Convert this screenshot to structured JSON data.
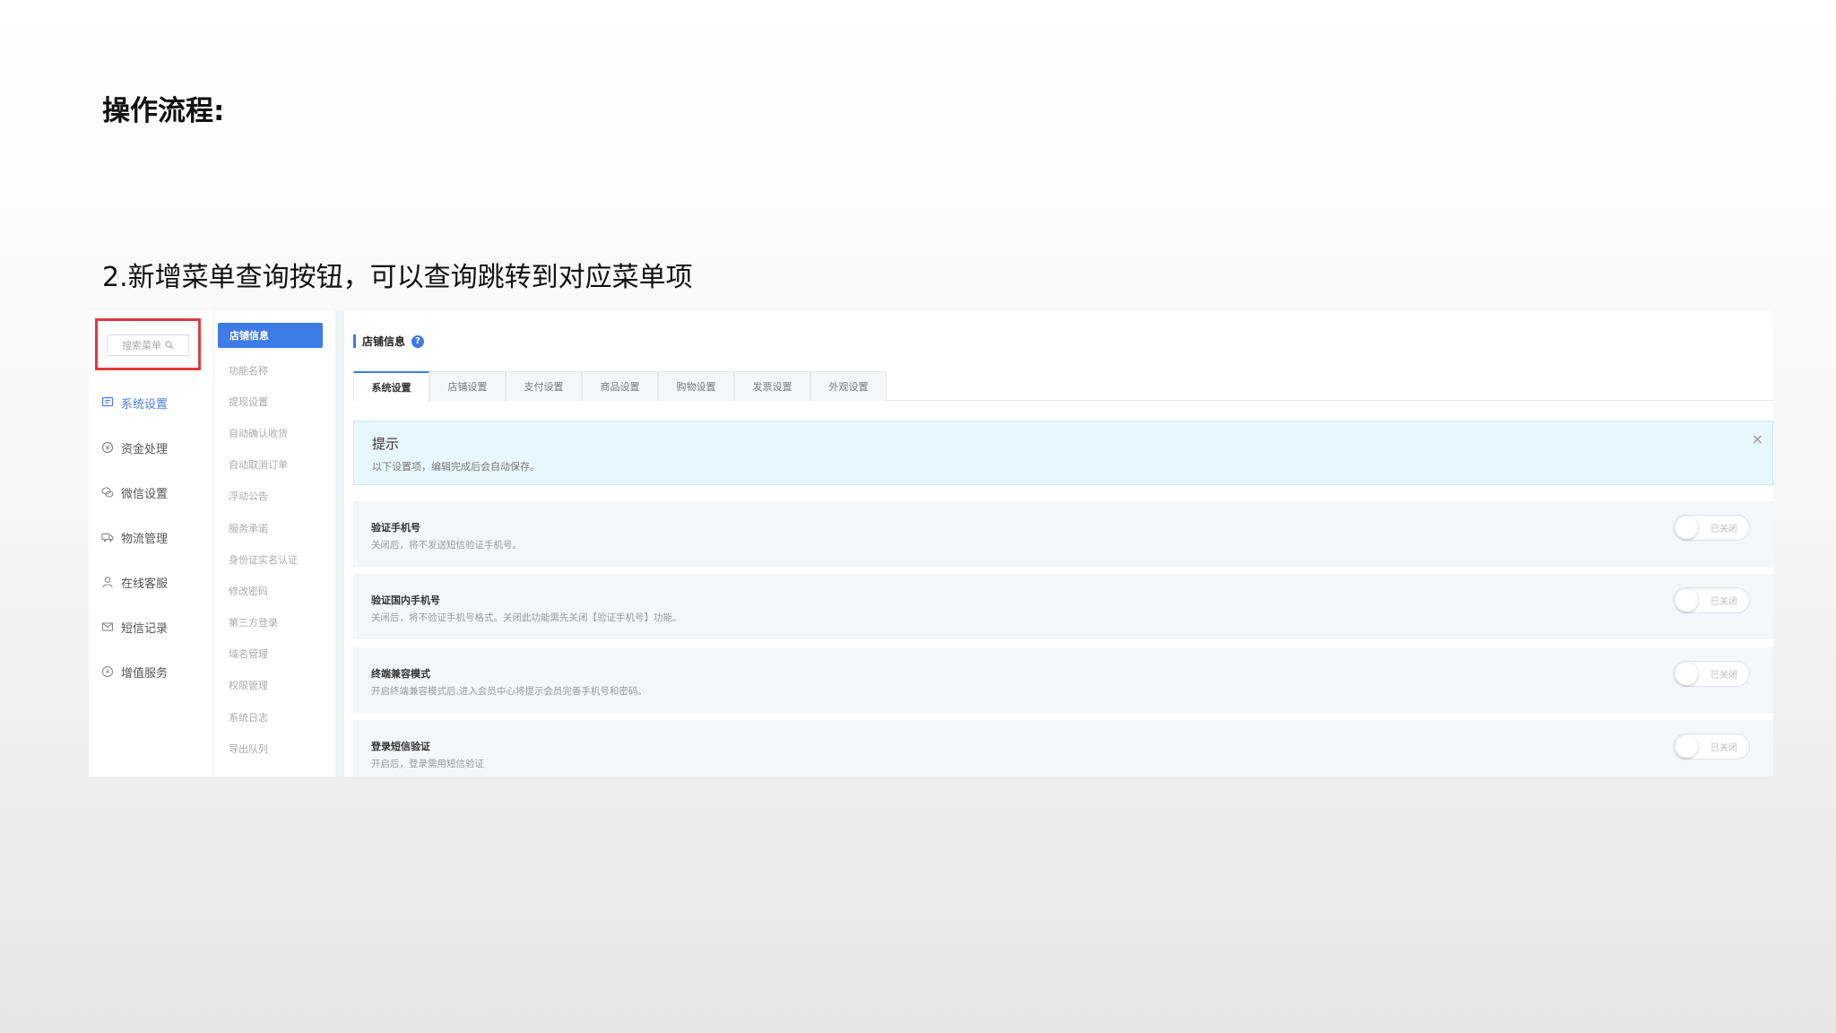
{
  "slide": {
    "title": "操作流程:",
    "subtitle": "2.新增菜单查询按钮，可以查询跳转到对应菜单项"
  },
  "colors": {
    "accent": "#3d7be6",
    "highlight_border": "#e0393e",
    "notice_bg": "#e8f6fd"
  },
  "sidebar": {
    "search": {
      "placeholder": "搜索菜单",
      "icon": "search-icon"
    },
    "items": [
      {
        "label": "系统设置",
        "icon": "settings-doc-icon",
        "active": true
      },
      {
        "label": "资金处理",
        "icon": "money-icon",
        "active": false
      },
      {
        "label": "微信设置",
        "icon": "wechat-icon",
        "active": false
      },
      {
        "label": "物流管理",
        "icon": "truck-icon",
        "active": false
      },
      {
        "label": "在线客服",
        "icon": "user-icon",
        "active": false
      },
      {
        "label": "短信记录",
        "icon": "mail-icon",
        "active": false
      },
      {
        "label": "增值服务",
        "icon": "service-icon",
        "active": false
      }
    ]
  },
  "submenu": {
    "header": "店铺信息",
    "items": [
      "功能名称",
      "提现设置",
      "自动确认收货",
      "自动取消订单",
      "浮动公告",
      "服务承诺",
      "身份证实名认证",
      "修改密码",
      "第三方登录",
      "域名管理",
      "权限管理",
      "系统日志",
      "导出队列"
    ]
  },
  "main": {
    "section_title": "店铺信息",
    "help_icon": "?",
    "tabs": [
      "系统设置",
      "店铺设置",
      "支付设置",
      "商品设置",
      "购物设置",
      "发票设置",
      "外观设置"
    ],
    "notice": {
      "title": "提示",
      "text": "以下设置项，编辑完成后会自动保存。",
      "close": "×"
    },
    "settings": [
      {
        "title": "验证手机号",
        "desc": "关闭后，将不发送短信验证手机号。",
        "toggle": "已关闭"
      },
      {
        "title": "验证国内手机号",
        "desc": "关闭后，将不验证手机号格式。关闭此功能需先关闭【验证手机号】功能。",
        "toggle": "已关闭"
      },
      {
        "title": "终端兼容模式",
        "desc": "开启终端兼容模式后,进入会员中心将提示会员完善手机号和密码。",
        "toggle": "已关闭"
      },
      {
        "title": "登录短信验证",
        "desc": "开启后，登录需用短信验证",
        "toggle": "已关闭"
      }
    ]
  }
}
